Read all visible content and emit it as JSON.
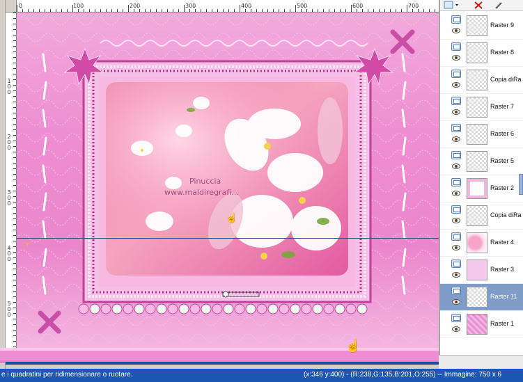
{
  "ruler": {
    "top_labels": [
      "0",
      "100",
      "200",
      "300",
      "400",
      "500",
      "600",
      "700"
    ],
    "left_labels": [
      "1\n0\n0",
      "2\n0\n0",
      "3\n0\n0",
      "4\n0\n0",
      "5\n0\n0"
    ]
  },
  "canvas": {
    "watermark_line1": "Pinuccia",
    "watermark_line2": "www.maldiregrafi..."
  },
  "layers": [
    {
      "name": "Raster 9",
      "thumb": "transparent"
    },
    {
      "name": "Raster 8",
      "thumb": "transparent"
    },
    {
      "name": "Copia diRa",
      "thumb": "transparent"
    },
    {
      "name": "Raster 7",
      "thumb": "transparent"
    },
    {
      "name": "Raster 6",
      "thumb": "transparent"
    },
    {
      "name": "Raster 5",
      "thumb": "transparent"
    },
    {
      "name": "Raster 2",
      "thumb": "frame"
    },
    {
      "name": "Copia diRa",
      "thumb": "transparent"
    },
    {
      "name": "Raster 4",
      "thumb": "flowers"
    },
    {
      "name": "Raster 3",
      "thumb": "pink"
    },
    {
      "name": "Raster 11",
      "thumb": "transparent",
      "selected": true
    },
    {
      "name": "Raster 1",
      "thumb": "pink-pattern"
    }
  ],
  "status": {
    "hint": "e i quadratini per ridimensionare o ruotare.",
    "coords": "(x:346 y:400) - (R:238,G:135,B:201,O:255) -- Immagine:  750 x 6"
  },
  "icons": {
    "layer_type": "raster-layer-icon",
    "visibility": "eye-icon",
    "pointer": "hand-pointer-icon"
  },
  "colors": {
    "canvas_pink": "#ee8fd1",
    "status_blue": "#1c58b3",
    "selected_layer": "#7f9dc8"
  }
}
